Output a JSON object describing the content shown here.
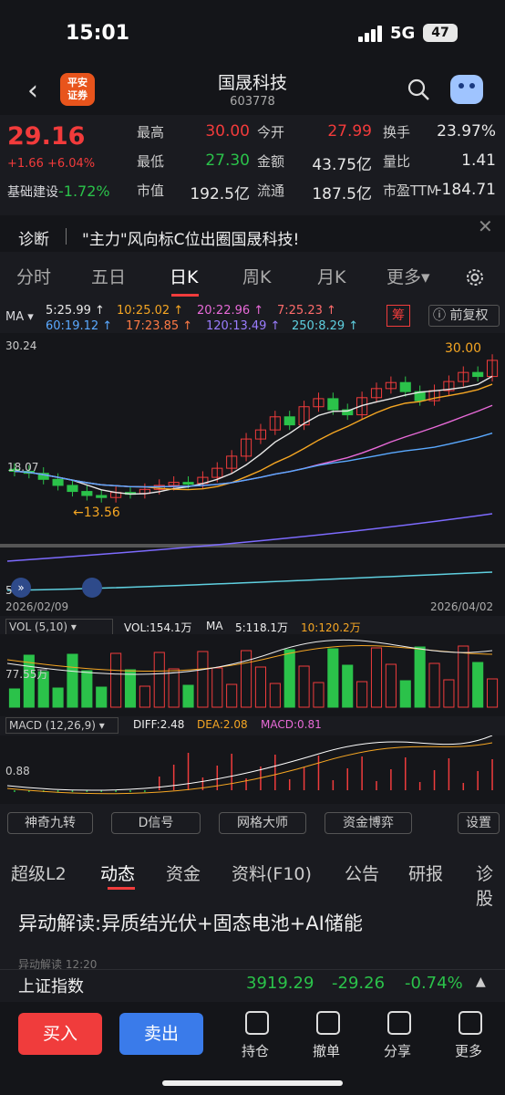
{
  "status": {
    "time": "15:01",
    "network": "5G",
    "battery": "47"
  },
  "header": {
    "title": "国晟科技",
    "code": "603778",
    "logo_line1": "平安",
    "logo_line2": "证券",
    "back_icon": "chevron-left-icon",
    "search_icon": "search-icon",
    "bot_icon": "robot-icon"
  },
  "quote": {
    "price": "29.16",
    "change": "+1.66 +6.04%",
    "sector": "基础建设",
    "sector_change": "-1.72%",
    "metrics": [
      {
        "label": "最高",
        "value": "30.00",
        "color": "#f23b3b"
      },
      {
        "label": "今开",
        "value": "27.99",
        "color": "#f23b3b"
      },
      {
        "label": "换手",
        "value": "23.97%",
        "color": "#e8e8e8"
      },
      {
        "label": "最低",
        "value": "27.30",
        "color": "#2bc24a"
      },
      {
        "label": "金额",
        "value": "43.75亿",
        "color": "#e8e8e8"
      },
      {
        "label": "量比",
        "value": "1.41",
        "color": "#e8e8e8"
      },
      {
        "label": "市值",
        "value": "192.5亿",
        "color": "#e8e8e8"
      },
      {
        "label": "流通",
        "value": "187.5亿",
        "color": "#e8e8e8"
      },
      {
        "label": "市盈TTM",
        "value": "-184.71",
        "color": "#e8e8e8"
      }
    ]
  },
  "notice": {
    "label": "诊断",
    "text": "\"主力\"风向标C位出圈国晟科技!",
    "close_icon": "close-icon"
  },
  "period_tabs": [
    "分时",
    "五日",
    "日K",
    "周K",
    "月K",
    "更多"
  ],
  "active_period": "日K",
  "ma": {
    "label": "MA",
    "items": [
      {
        "text": "5:25.99",
        "color": "#e8e8e8"
      },
      {
        "text": "10:25.02",
        "color": "#f5a623"
      },
      {
        "text": "20:22.96",
        "color": "#e86ad8"
      },
      {
        "text": "7:25.23",
        "color": "#ff6b6b"
      },
      {
        "text": "60:19.12",
        "color": "#5aa9ff"
      },
      {
        "text": "17:23.85",
        "color": "#ff7a45"
      },
      {
        "text": "120:13.49",
        "color": "#9b7dff"
      },
      {
        "text": "250:8.29",
        "color": "#5fd0e0"
      }
    ],
    "chip_label": "筹",
    "adjust_label": "前复权"
  },
  "kline": {
    "y_high": "30.24",
    "y_mid": "18.07",
    "low_label": "13.56",
    "high_label": "30.00",
    "date_start": "2026/02/09",
    "date_end": "2026/04/02",
    "marker_left": "5.1"
  },
  "vol": {
    "label": "VOL (5,10)",
    "vol": "VOL:154.1万",
    "ma5": "5:118.1万",
    "ma10": "10:120.2万",
    "ma_label": "MA",
    "axis": "77.55万"
  },
  "macd": {
    "label": "MACD (12,26,9)",
    "diff": "DIFF:2.48",
    "dea": "DEA:2.08",
    "macd": "MACD:0.81",
    "axis": "0.88"
  },
  "tools": [
    "神奇九转",
    "D信号",
    "网格大师",
    "资金博弈",
    "设置"
  ],
  "section_tabs": [
    "超级L2",
    "动态",
    "资金",
    "资料(F10)",
    "公告",
    "研报",
    "诊股"
  ],
  "active_section": "动态",
  "news": {
    "headline": "异动解读:异质结光伏+固态电池+AI储能",
    "sub": "异动解读 12:20"
  },
  "index": {
    "name": "上证指数",
    "value": "3919.29",
    "change": "-29.26",
    "pct": "-0.74%"
  },
  "bottom": {
    "buy": "买入",
    "sell": "卖出",
    "actions": [
      "持仓",
      "撤单",
      "分享",
      "更多"
    ]
  },
  "chart_data": {
    "type": "candlestick",
    "closes": [
      18.2,
      18.0,
      17.4,
      16.8,
      16.2,
      15.8,
      15.6,
      16.1,
      16.0,
      16.4,
      16.8,
      17.1,
      17.0,
      17.6,
      18.5,
      19.7,
      21.4,
      22.3,
      23.6,
      22.8,
      24.6,
      25.4,
      24.3,
      23.8,
      25.5,
      26.4,
      27.0,
      26.1,
      25.2,
      26.2,
      27.1,
      28.0,
      27.6,
      29.2
    ]
  }
}
